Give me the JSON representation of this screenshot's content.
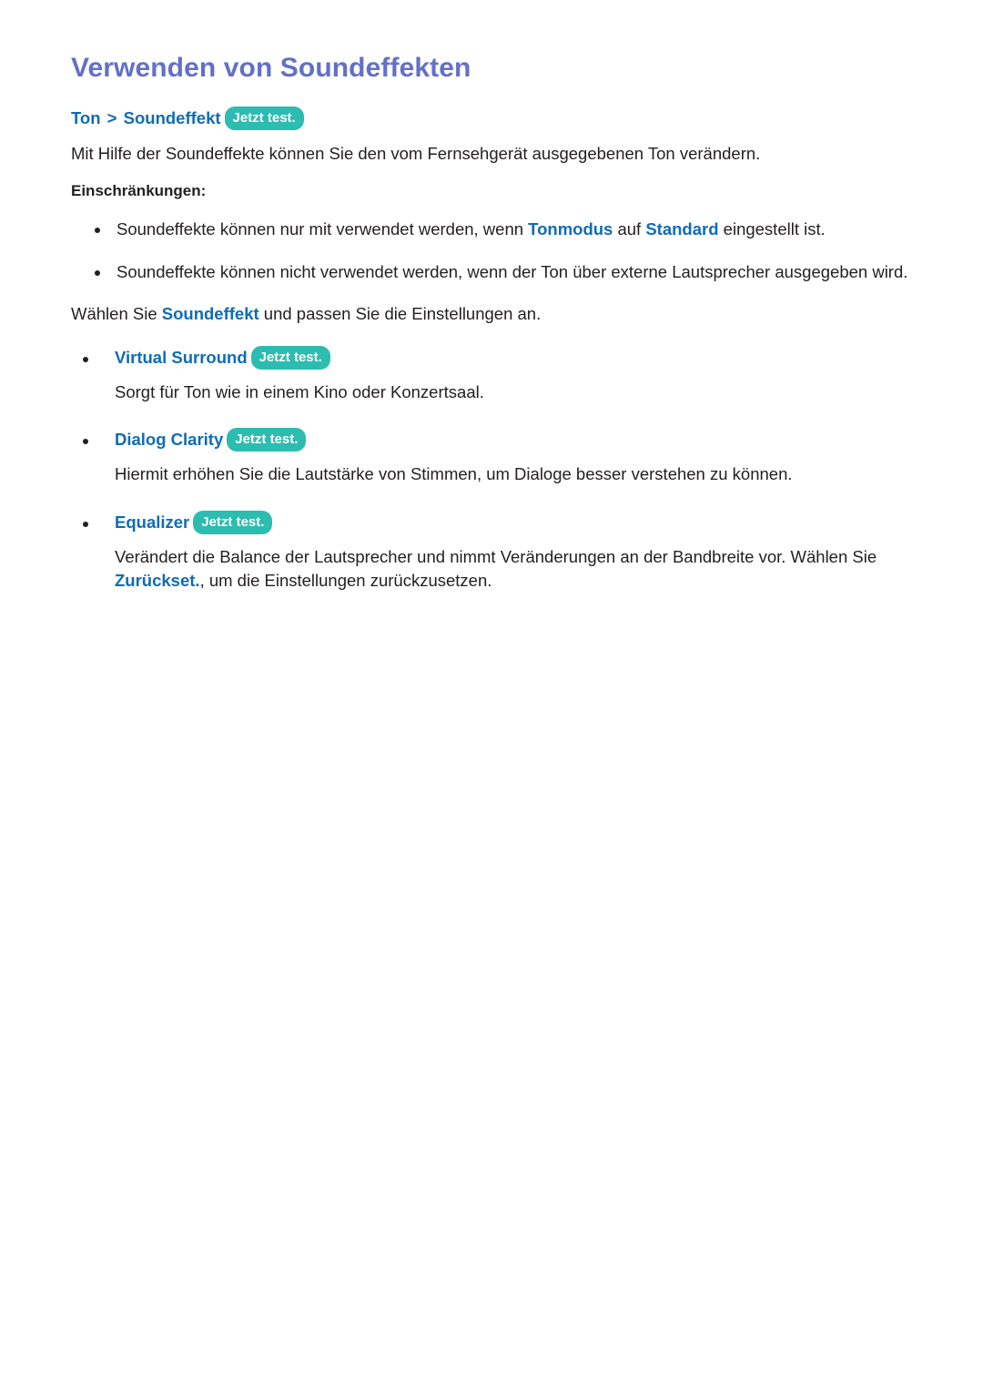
{
  "page": {
    "title": "Verwenden von Soundeffekten",
    "accent_title_color": "#6370c6",
    "accent_link_color": "#0f6cb6",
    "badge_color": "#2dbcb0",
    "body_color": "#231f20"
  },
  "breadcrumb": {
    "root": "Ton",
    "separator": ">",
    "leaf": "Soundeffekt",
    "badge": "Jetzt test."
  },
  "intro": {
    "text": "Mit Hilfe der Soundeffekte können Sie den vom Fernsehgerät ausgegebenen Ton verändern."
  },
  "restrictions": {
    "heading": "Einschränkungen:",
    "items": [
      {
        "part1": "Soundeffekte können nur mit verwendet werden, wenn ",
        "link1": "Tonmodus",
        "part2": " auf ",
        "link2": "Standard",
        "part3": " eingestellt ist."
      },
      {
        "part1": "Soundeffekte können nicht verwendet werden, wenn der Ton über externe Lautsprecher ausgegeben wird.",
        "link1": "",
        "part2": "",
        "link2": "",
        "part3": ""
      }
    ]
  },
  "lead": {
    "part1": "Wählen Sie ",
    "link": "Soundeffekt",
    "part2": " und passen Sie die Einstellungen an."
  },
  "options": [
    {
      "name": "Virtual Surround",
      "badge": "Jetzt test.",
      "desc_part1": "Sorgt für Ton wie in einem Kino oder Konzertsaal.",
      "desc_link": "",
      "desc_part2": ""
    },
    {
      "name": "Dialog Clarity",
      "badge": "Jetzt test.",
      "desc_part1": "Hiermit erhöhen Sie die Lautstärke von Stimmen, um Dialoge besser verstehen zu können.",
      "desc_link": "",
      "desc_part2": ""
    },
    {
      "name": "Equalizer",
      "badge": "Jetzt test.",
      "desc_part1": "Verändert die Balance der Lautsprecher und nimmt Veränderungen an der Bandbreite vor. Wählen Sie ",
      "desc_link": "Zurückset.",
      "desc_part2": ", um die  Einstellungen zurückzusetzen."
    }
  ]
}
